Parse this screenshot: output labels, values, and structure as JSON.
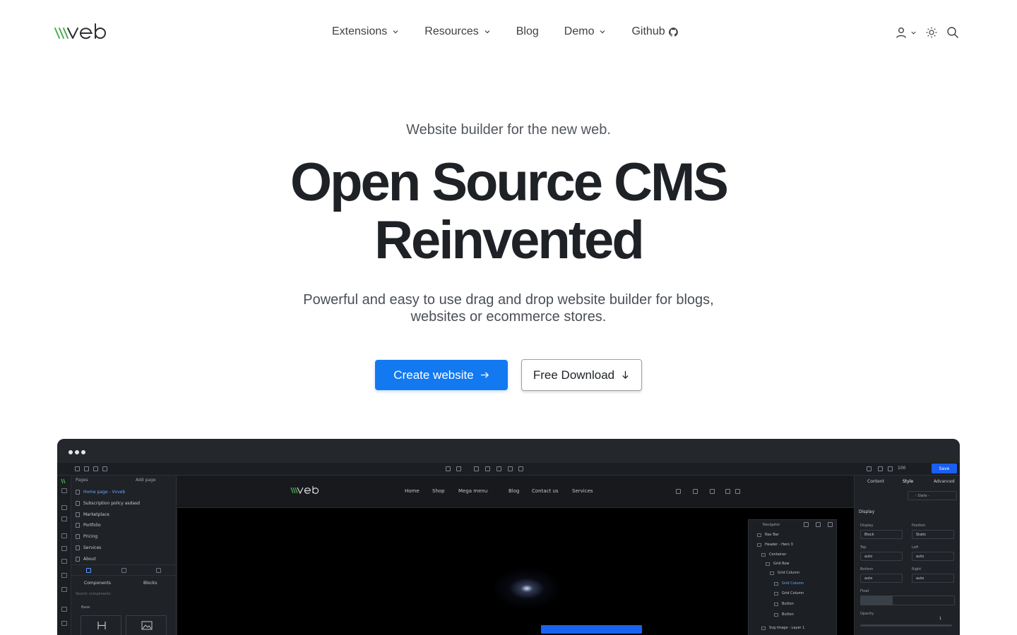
{
  "navbar": {
    "links": [
      {
        "label": "Extensions",
        "has_dropdown": true
      },
      {
        "label": "Resources",
        "has_dropdown": true
      },
      {
        "label": "Blog",
        "has_dropdown": false
      },
      {
        "label": "Demo",
        "has_dropdown": true
      },
      {
        "label": "Github",
        "has_dropdown": false,
        "icon": "github-icon"
      }
    ],
    "right_icons": [
      "user-icon",
      "chevron-down-icon",
      "sun-icon",
      "search-icon"
    ]
  },
  "hero": {
    "tagline": "Website builder for the new web.",
    "title_line1": "Open Source CMS",
    "title_line2": "Reinvented",
    "description": "Powerful and easy to use drag and drop website builder for blogs, websites or ecommerce stores.",
    "primary_button": "Create website",
    "secondary_button": "Free Download"
  },
  "colors": {
    "primary": "#1379f1",
    "logo_green": "#4caf50",
    "editor_bg": "#1d2024",
    "save_button": "#1a5ff0"
  },
  "editor": {
    "toolbar": {
      "zoom": "100",
      "save_label": "Save"
    },
    "left_panel": {
      "pages_header": "Pages",
      "add_page": "Add page",
      "pages": [
        {
          "label": "Home page - Vvveb",
          "active": true
        },
        {
          "label": "Subscription policy asdasd",
          "active": false
        },
        {
          "label": "Marketplace",
          "active": false
        },
        {
          "label": "Portfolio",
          "active": false
        },
        {
          "label": "Pricing",
          "active": false
        },
        {
          "label": "Services",
          "active": false
        },
        {
          "label": "About",
          "active": false
        }
      ],
      "tab_components": "Components",
      "tab_blocks": "Blocks",
      "search_placeholder": "Search components",
      "section_base": "Base"
    },
    "canvas": {
      "nav_links": [
        "Home",
        "Shop",
        "Mega menu",
        "Blog",
        "Contact us",
        "Services"
      ]
    },
    "navigator": {
      "title": "Navigator",
      "rows": [
        {
          "label": "Nav Bar",
          "selected": false
        },
        {
          "label": "Header - Hero 3",
          "selected": false
        },
        {
          "label": "Container",
          "selected": false
        },
        {
          "label": "Grid Row",
          "selected": false
        },
        {
          "label": "Grid Column",
          "selected": false
        },
        {
          "label": "Grid Column",
          "selected": true
        },
        {
          "label": "Grid Column",
          "selected": false
        },
        {
          "label": "Button",
          "selected": false
        },
        {
          "label": "Button",
          "selected": false
        },
        {
          "label": "Svg Image - Layer 1",
          "selected": false
        }
      ]
    },
    "right_panel": {
      "tabs": [
        "Content",
        "Style",
        "Advanced"
      ],
      "state": "- State -",
      "section": "Display",
      "fields": {
        "display_label": "Display",
        "display_value": "Block",
        "position_label": "Position",
        "position_value": "Static",
        "top_label": "Top",
        "top_value": "auto",
        "left_label": "Left",
        "left_value": "auto",
        "bottom_label": "Bottom",
        "bottom_value": "auto",
        "right_label": "Right",
        "right_value": "auto",
        "float_label": "Float",
        "opacity_label": "Opacity",
        "opacity_value": "1"
      }
    }
  }
}
